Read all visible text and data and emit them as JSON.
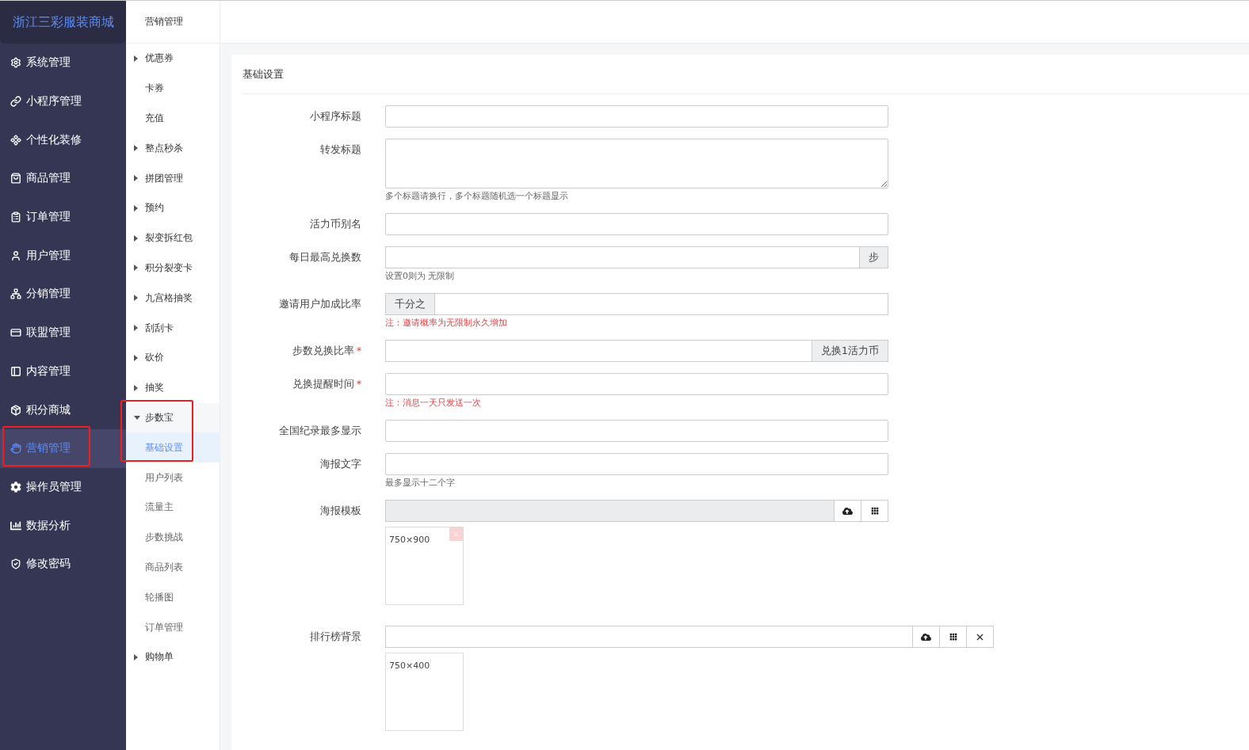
{
  "sidebar": {
    "brand": "浙江三彩服装商城",
    "items": [
      {
        "label": "系统管理",
        "selected": false,
        "highlighted": false
      },
      {
        "label": "小程序管理",
        "selected": false,
        "highlighted": false
      },
      {
        "label": "个性化装修",
        "selected": false,
        "highlighted": false
      },
      {
        "label": "商品管理",
        "selected": false,
        "highlighted": false
      },
      {
        "label": "订单管理",
        "selected": false,
        "highlighted": false
      },
      {
        "label": "用户管理",
        "selected": false,
        "highlighted": false
      },
      {
        "label": "分销管理",
        "selected": false,
        "highlighted": false
      },
      {
        "label": "联盟管理",
        "selected": false,
        "highlighted": false
      },
      {
        "label": "内容管理",
        "selected": false,
        "highlighted": false
      },
      {
        "label": "积分商城",
        "selected": false,
        "highlighted": false
      },
      {
        "label": "营销管理",
        "selected": true,
        "highlighted": true
      },
      {
        "label": "操作员管理",
        "selected": false,
        "highlighted": false
      },
      {
        "label": "数据分析",
        "selected": false,
        "highlighted": false
      },
      {
        "label": "修改密码",
        "selected": false,
        "highlighted": false
      }
    ]
  },
  "submenu": {
    "title": "营销管理",
    "items": [
      {
        "kind": "group",
        "label": "优惠券",
        "expanded": false,
        "highlighted": false
      },
      {
        "kind": "link",
        "label": "卡券",
        "selected": false
      },
      {
        "kind": "link",
        "label": "充值",
        "selected": false
      },
      {
        "kind": "group",
        "label": "整点秒杀",
        "expanded": false,
        "highlighted": false
      },
      {
        "kind": "group",
        "label": "拼团管理",
        "expanded": false,
        "highlighted": false
      },
      {
        "kind": "group",
        "label": "预约",
        "expanded": false,
        "highlighted": false
      },
      {
        "kind": "group",
        "label": "裂变拆红包",
        "expanded": false,
        "highlighted": false
      },
      {
        "kind": "group",
        "label": "积分裂变卡",
        "expanded": false,
        "highlighted": false
      },
      {
        "kind": "group",
        "label": "九宫格抽奖",
        "expanded": false,
        "highlighted": false
      },
      {
        "kind": "group",
        "label": "刮刮卡",
        "expanded": false,
        "highlighted": false
      },
      {
        "kind": "group",
        "label": "砍价",
        "expanded": false,
        "highlighted": false
      },
      {
        "kind": "group",
        "label": "抽奖",
        "expanded": false,
        "highlighted": false
      },
      {
        "kind": "group",
        "label": "步数宝",
        "expanded": true,
        "highlighted": true,
        "children": [
          {
            "label": "基础设置",
            "selected": true
          },
          {
            "label": "用户列表",
            "selected": false
          },
          {
            "label": "流量主",
            "selected": false
          },
          {
            "label": "步数挑战",
            "selected": false
          },
          {
            "label": "商品列表",
            "selected": false
          },
          {
            "label": "轮播图",
            "selected": false
          },
          {
            "label": "订单管理",
            "selected": false
          }
        ]
      },
      {
        "kind": "group",
        "label": "购物单",
        "expanded": false,
        "highlighted": false
      }
    ]
  },
  "panel": {
    "title": "基础设置",
    "fields": [
      {
        "kind": "input",
        "label": "小程序标题"
      },
      {
        "kind": "textarea",
        "label": "转发标题",
        "hint": "多个标题请换行，多个标题随机选一个标题显示",
        "warning": false
      },
      {
        "kind": "input",
        "label": "活力币别名"
      },
      {
        "kind": "input-suffix",
        "label": "每日最高兑换数",
        "addon": "步",
        "hint": "设置0则为 无限制",
        "warning": false
      },
      {
        "kind": "input-prefix",
        "label": "邀请用户加成比率",
        "addon": "千分之",
        "hint": "注：邀请概率为无限制永久增加",
        "warning": true
      },
      {
        "kind": "input-suffix",
        "label": "步数兑换比率",
        "required_mark": "*",
        "addon": "兑换1活力币"
      },
      {
        "kind": "input",
        "label": "兑换提醒时间",
        "required_mark": "*",
        "hint": "注：消息一天只发送一次",
        "warning": true
      },
      {
        "kind": "input",
        "label": "全国纪录最多显示"
      },
      {
        "kind": "input",
        "label": "海报文字",
        "hint": "最多显示十二个字",
        "warning": false
      },
      {
        "kind": "image",
        "label": "海报模板",
        "disabled": true,
        "clearable": false,
        "thumb": "750×900",
        "removable": true
      },
      {
        "kind": "image",
        "label": "排行榜背景",
        "disabled": false,
        "clearable": true,
        "thumb": "750×400",
        "removable": false
      }
    ]
  }
}
